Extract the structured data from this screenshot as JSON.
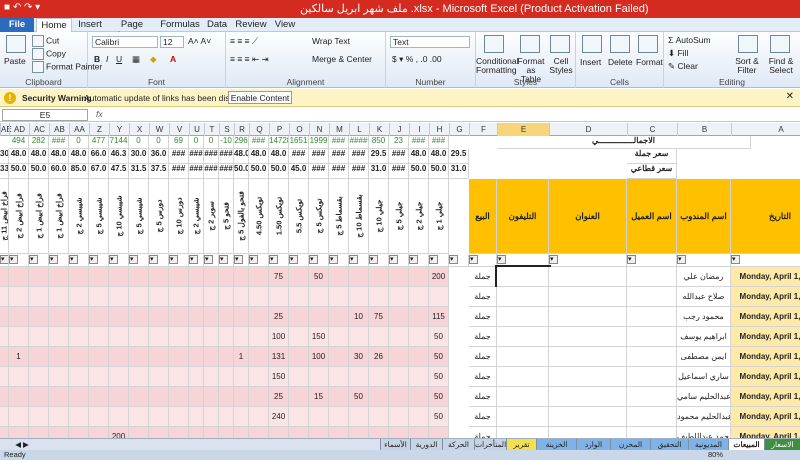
{
  "window": {
    "title": "ملف شهر ابريل سالكين .xlsx  -  Microsoft Excel (Product Activation Failed)"
  },
  "ribbon_tabs": [
    "File",
    "Home",
    "Insert",
    "Page Layout",
    "Formulas",
    "Data",
    "Review",
    "View"
  ],
  "ribbon": {
    "paste": "Paste",
    "cut": "Cut",
    "copy": "Copy",
    "format_painter": "Format Painter",
    "clipboard": "Clipboard",
    "font_name": "Calibri",
    "font_size": "12",
    "font": "Font",
    "wrap_text": "Wrap Text",
    "merge_center": "Merge & Center",
    "alignment": "Alignment",
    "number_format": "Text",
    "number": "Number",
    "conditional": "Conditional Formatting",
    "format_table": "Format as Table",
    "cell_styles": "Cell Styles",
    "styles": "Styles",
    "insert": "Insert",
    "delete": "Delete",
    "format": "Format",
    "cells": "Cells",
    "autosum": "AutoSum",
    "fill": "Fill",
    "clear": "Clear",
    "sort_filter": "Sort & Filter",
    "find_select": "Find & Select",
    "editing": "Editing"
  },
  "security": {
    "label": "Security Warning",
    "message": "Automatic update of links has been disabled",
    "button": "Enable Content"
  },
  "formula_bar": {
    "namebox": "E5",
    "fx": "fx"
  },
  "columns": [
    "AE",
    "AD",
    "AC",
    "AB",
    "AA",
    "Z",
    "Y",
    "X",
    "W",
    "V",
    "U",
    "T",
    "S",
    "R",
    "Q",
    "P",
    "O",
    "N",
    "M",
    "L",
    "K",
    "J",
    "I",
    "H",
    "G",
    "F",
    "E",
    "D",
    "C",
    "B",
    "A"
  ],
  "totals_row1": [
    "494",
    "282",
    "###",
    "0",
    "477",
    "7144",
    "0",
    "0",
    "69",
    "0",
    "0",
    "-10",
    "296",
    "###",
    "14728",
    "1651",
    "1999",
    "###",
    "####",
    "850",
    "23",
    "###",
    "###",
    "2420"
  ],
  "totals_label": "الاجمالـــــــــــــــي",
  "price_row1": [
    "30.0",
    "48.0",
    "48.0",
    "48.0",
    "48.0",
    "66.0",
    "46.3",
    "30.0",
    "36.0",
    "###",
    "###",
    "###",
    "###",
    "48.0",
    "48.0",
    "48.0",
    "###",
    "###",
    "###",
    "###",
    "29.5",
    "###",
    "48.0",
    "48.0",
    "29.5"
  ],
  "price_row1_label": "سعر جملة",
  "price_row2": [
    "33.0",
    "50.0",
    "50.0",
    "60.0",
    "85.0",
    "67.0",
    "47.5",
    "31.5",
    "37.5",
    "###",
    "###",
    "###",
    "###",
    "50.0",
    "50.0",
    "50.0",
    "45.0",
    "###",
    "###",
    "###",
    "31.0",
    "###",
    "50.0",
    "50.0",
    "31.0"
  ],
  "price_row2_label": "سعر قطاعي",
  "product_headers": [
    "فراخ ابيض 11 ج",
    "فراخ ابيض 2 ج",
    "فراخ ابيض 1 ج",
    "فراخ ابيض 1 ج",
    "شيبسي 2 ج",
    "شيبسي 5 ج",
    "شيبسي 10 ج",
    "شيبسي 5 ج",
    "دورس 5 ج",
    "دورس 10 ج",
    "شيبسي 2 ج",
    "سوبر 2 ج",
    "فتحو 5 ج",
    "فتحو بالفول 5 ج",
    "تويكس 4.50",
    "تويكس 1.50",
    "تويكس 5.5",
    "تويكس 5 ج",
    "بقسماط 5 ج",
    "بقسماط 10 ج",
    "جيلي 10 ج",
    "جيلي 5 ج",
    "جيلي 2 ج",
    "جيلي 1 ج"
  ],
  "main_headers": {
    "sale": "البيع",
    "phone": "التليفون",
    "address": "العنوان",
    "customer": "اسم العميل",
    "rep": "اسم المندوب",
    "date": "التاريخ"
  },
  "rows": [
    {
      "date": "Monday, April 1, 2024",
      "rep": "رمضان علي",
      "sale": "جملة",
      "vals": {
        "P": "75",
        "N": "50",
        "H": "200"
      }
    },
    {
      "date": "Monday, April 1, 2024",
      "rep": "صلاح عبدالله",
      "sale": "جملة",
      "vals": {}
    },
    {
      "date": "Monday, April 1, 2024",
      "rep": "محمود رجب",
      "sale": "جملة",
      "vals": {
        "P": "25",
        "L": "10",
        "K": "75",
        "H": "115",
        "G": "75"
      }
    },
    {
      "date": "Monday, April 1, 2024",
      "rep": "ابراهيم يوسف",
      "sale": "جملة",
      "vals": {
        "P": "100",
        "N": "150",
        "H": "50"
      }
    },
    {
      "date": "Monday, April 1, 2024",
      "rep": "ايمن مصطفى",
      "sale": "جملة",
      "vals": {
        "AD": "1",
        "R": "1",
        "P": "131",
        "N": "100",
        "L": "30",
        "K": "26",
        "H": "50",
        "G": "27"
      }
    },
    {
      "date": "Monday, April 1, 2024",
      "rep": "ساري اسماعيل",
      "sale": "جملة",
      "vals": {
        "P": "150",
        "H": "50"
      }
    },
    {
      "date": "Monday, April 1, 2024",
      "rep": "عبدالحليم سامي",
      "sale": "جملة",
      "vals": {
        "P": "25",
        "N": "15",
        "L": "50",
        "H": "50",
        "G": "50"
      }
    },
    {
      "date": "Monday, April 1, 2024",
      "rep": "عبدالحليم محمود",
      "sale": "جملة",
      "vals": {
        "P": "240",
        "H": "50"
      }
    },
    {
      "date": "Monday, April 1, 2024",
      "rep": "محمد عبداللطيف",
      "sale": "جملة",
      "vals": {
        "Y": "200"
      }
    }
  ],
  "sheet_tabs": [
    "الاسعار",
    "المبيعات",
    "المديونية",
    "التحقيق",
    "المخزن",
    "الوارد",
    "الخزينة",
    "تقرير",
    "المتأخرات",
    "الحركة",
    "الدورية",
    "الأسماء"
  ],
  "status": {
    "ready": "Ready",
    "zoom": "80%"
  }
}
